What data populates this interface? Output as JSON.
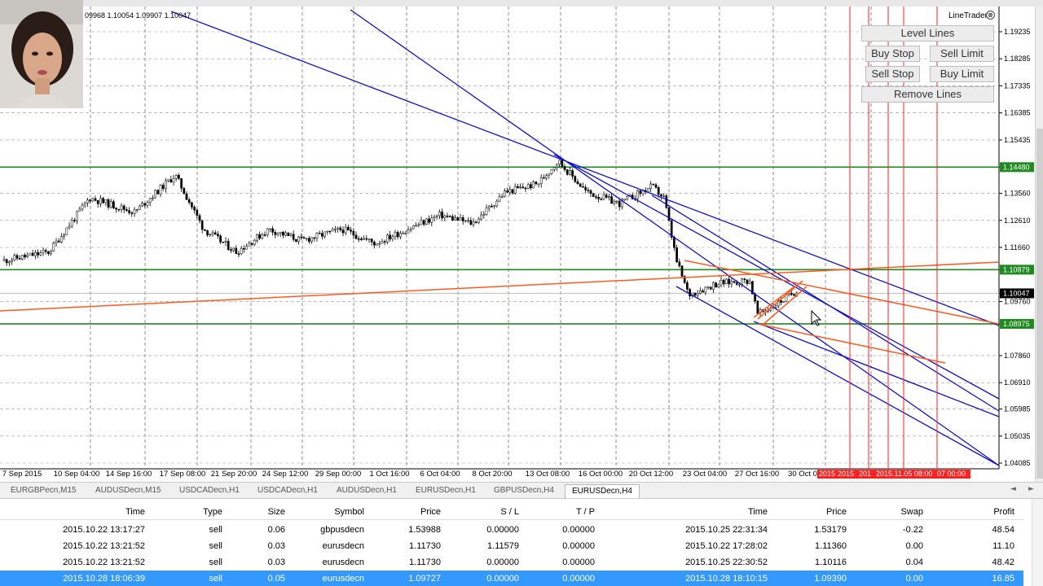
{
  "ohlc_readout": "09968 1.10054 1.09907 1.10047",
  "line_trader": {
    "title": "LineTrader",
    "close_symbol": "⊗",
    "buttons": {
      "level_lines": "Level Lines",
      "buy_stop": "Buy Stop",
      "sell_limit": "Sell Limit",
      "sell_stop": "Sell Stop",
      "buy_limit": "Buy Limit",
      "remove_lines": "Remove Lines"
    }
  },
  "price_axis": {
    "ticks": [
      "1.19235",
      "1.18285",
      "1.17335",
      "1.16385",
      "1.15435",
      "1.14480",
      "1.13560",
      "1.12610",
      "1.11660",
      "1.10879",
      "1.10047",
      "1.09760",
      "1.08975",
      "1.07860",
      "1.06910",
      "1.05985",
      "1.05035",
      "1.04085"
    ],
    "bid_price": "1.10047",
    "level_tags": [
      "1.14480",
      "1.10879",
      "1.08975"
    ]
  },
  "time_axis": {
    "labels": [
      "7 Sep 2015",
      "10 Sep 04:00",
      "14 Sep 16:00",
      "17 Sep 08:00",
      "21 Sep 20:00",
      "24 Sep 12:00",
      "29 Sep 00:00",
      "1 Oct 16:00",
      "6 Oct 04:00",
      "8 Oct 20:00",
      "13 Oct 08:00",
      "16 Oct 00:00",
      "20 Oct 12:00",
      "23 Oct 04:00",
      "27 Oct 16:00",
      "30 Oct 0"
    ],
    "future_labels": [
      "2015",
      "2015",
      "201",
      "2015.11.05 08:00",
      "07 00:00"
    ]
  },
  "chart_tabs": [
    "EURGBPecn,M15",
    "AUDUSDecn,M15",
    "USDCADecn,H1",
    "USDCADecn,H1",
    "AUDUSDecn,H1",
    "EURUSDecn,H1",
    "GBPUSDecn,H4",
    "EURUSDecn,H4"
  ],
  "active_tab_index": 7,
  "tab_nav": {
    "left": "◄",
    "right": "►"
  },
  "terminal": {
    "columns": [
      "Time",
      "Type",
      "Size",
      "Symbol",
      "Price",
      "S / L",
      "T / P",
      "Time",
      "Price",
      "Swap",
      "Profit"
    ],
    "rows": [
      [
        "2015.10.22 13:17:27",
        "sell",
        "0.06",
        "gbpusdecn",
        "1.53988",
        "0.00000",
        "0.00000",
        "2015.10.25 22:31:34",
        "1.53179",
        "-0.22",
        "48.54"
      ],
      [
        "2015.10.22 13:21:52",
        "sell",
        "0.03",
        "eurusdecn",
        "1.11730",
        "1.11579",
        "0.00000",
        "2015.10.22 17:28:02",
        "1.11360",
        "0.00",
        "11.10"
      ],
      [
        "2015.10.22 13:21:52",
        "sell",
        "0.03",
        "eurusdecn",
        "1.11730",
        "0.00000",
        "0.00000",
        "2015.10.25 22:30:52",
        "1.10116",
        "0.04",
        "48.42"
      ],
      [
        "2015.10.28 18:06:39",
        "sell",
        "0.05",
        "eurusdecn",
        "1.09727",
        "0.00000",
        "0.00000",
        "2015.10.28 18:10:15",
        "1.09390",
        "0.00",
        "16.85"
      ]
    ],
    "selected_row": 3
  },
  "colors": {
    "trend_line": "#1010cc",
    "support_resistance": "#1f8a1f",
    "channel_line": "#ff5a1f",
    "future_bar": "#ff2020",
    "selected_row": "#3399ff"
  }
}
